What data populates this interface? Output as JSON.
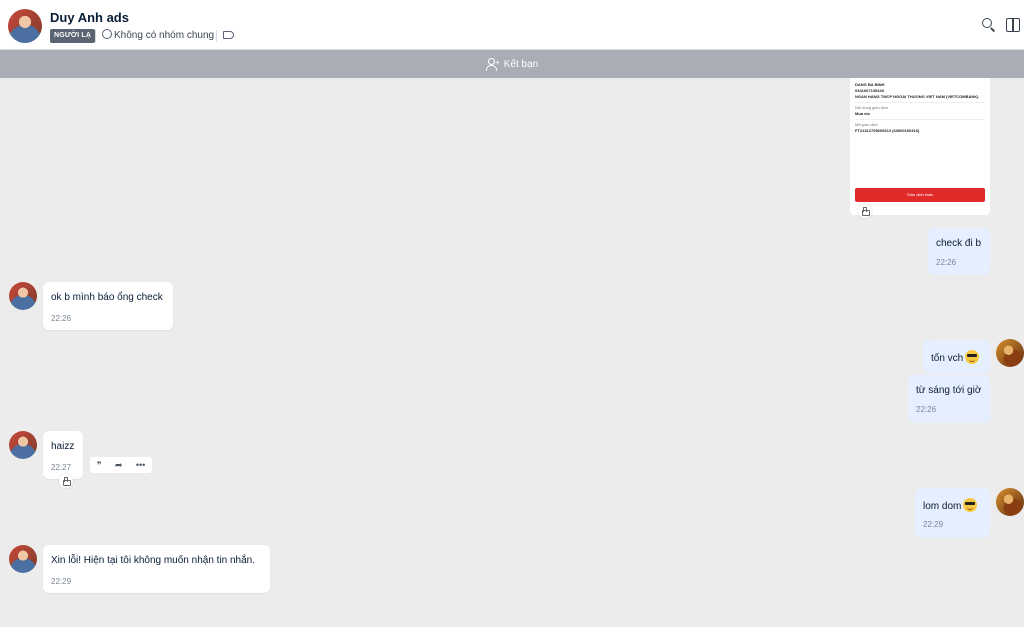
{
  "header": {
    "name": "Duy Anh ads",
    "badge": "NGƯỜI LẠ",
    "group_text": "Không có nhóm chung"
  },
  "friend_bar": {
    "label": "Kết bạn"
  },
  "receipt": {
    "recipient_name": "DANG BA BINH",
    "account": "0341007135440",
    "bank": "NGAN HANG TMCP NGOAI THUONG VIET NAM (VIETCOMBANK)",
    "content_label": "Nội dung giao dịch",
    "content": "Mua via",
    "code_label": "Mã giao dịch",
    "code": "FT21312799600613 (63000160316)",
    "button": "Giao dịch khác"
  },
  "messages": [
    {
      "side": "out",
      "text": "check đi b",
      "time": "22:26"
    },
    {
      "side": "in",
      "text": "ok b mình báo ổng check",
      "time": "22:26"
    },
    {
      "side": "out",
      "text": "tốn vch",
      "time": ""
    },
    {
      "side": "out",
      "text": "từ sáng tới giờ",
      "time": "22:26"
    },
    {
      "side": "in",
      "text": "haizz",
      "time": "22:27"
    },
    {
      "side": "out",
      "text": "lom dom",
      "time": "22:29"
    },
    {
      "side": "in",
      "text": "Xin lỗi! Hiện tại tôi không muốn nhận tin nhắn.",
      "time": "22:29"
    }
  ],
  "actions": {
    "quote": "❞",
    "forward": "➦",
    "more": "•••"
  }
}
